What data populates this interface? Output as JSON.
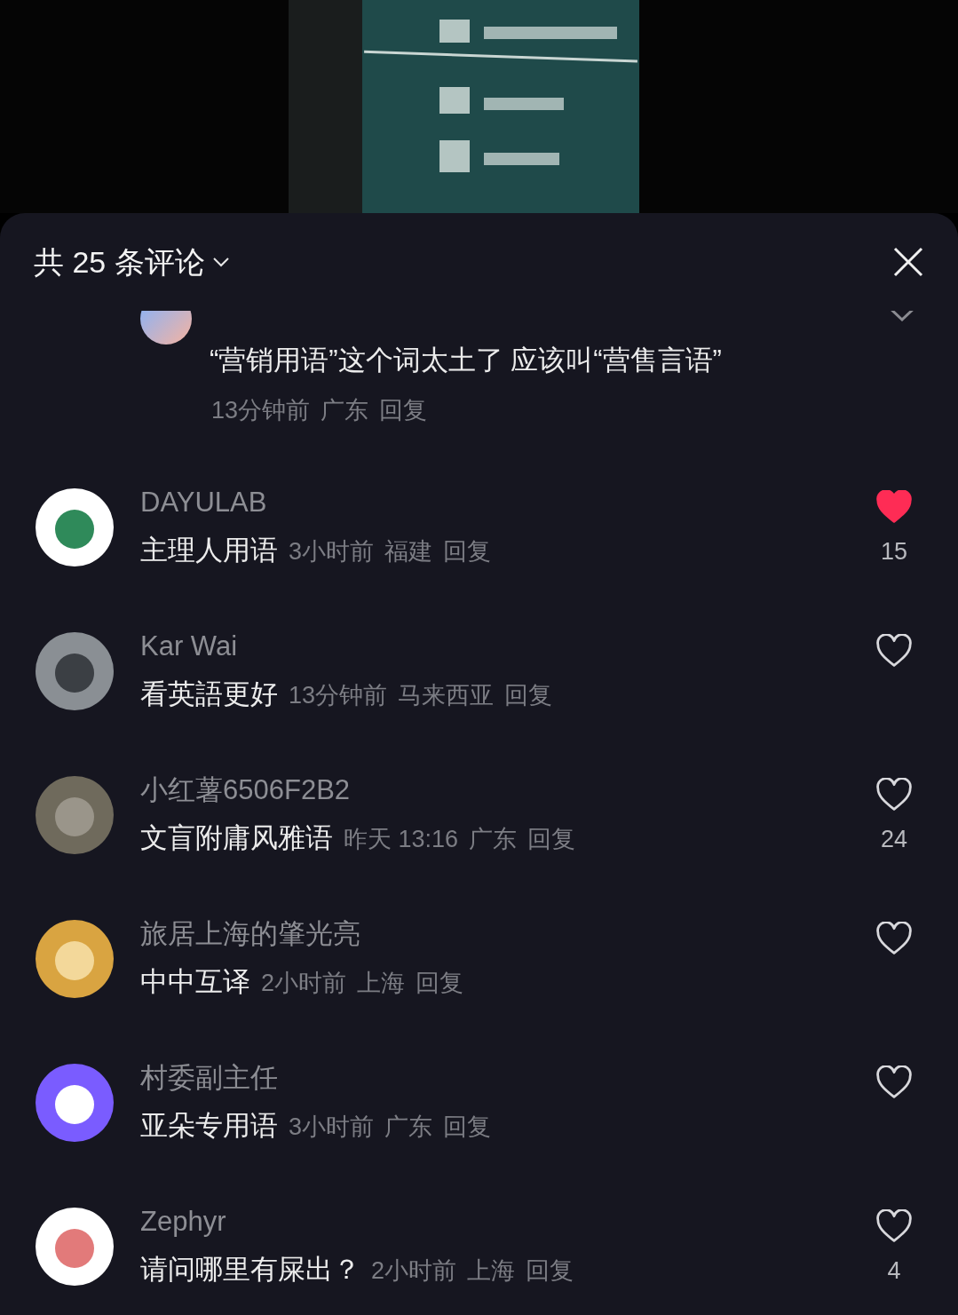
{
  "header": {
    "title": "共 25 条评论"
  },
  "reply": {
    "text": "“营销用语”这个词太土了 应该叫“营售言语”",
    "time": "13分钟前",
    "location": "广东",
    "reply_label": "回复"
  },
  "comments": [
    {
      "name": "DAYULAB",
      "text": "主理人用语",
      "time": "3小时前",
      "location": "福建",
      "reply_label": "回复",
      "liked": true,
      "like_count": "15"
    },
    {
      "name": "Kar Wai",
      "text": "看英語更好",
      "time": "13分钟前",
      "location": "马来西亚",
      "reply_label": "回复",
      "liked": false
    },
    {
      "name": "小红薯6506F2B2",
      "text": "文盲附庸风雅语",
      "time": "昨天 13:16",
      "location": "广东",
      "reply_label": "回复",
      "liked": false,
      "like_count": "24"
    },
    {
      "name": "旅居上海的肇光亮",
      "text": "中中互译",
      "time": "2小时前",
      "location": "上海",
      "reply_label": "回复",
      "liked": false
    },
    {
      "name": "村委副主任",
      "text": "亚朵专用语",
      "time": "3小时前",
      "location": "广东",
      "reply_label": "回复",
      "liked": false
    },
    {
      "name": "Zephyr",
      "text": "请问哪里有屎出？",
      "time": "2小时前",
      "location": "上海",
      "reply_label": "回复",
      "liked": false,
      "like_count": "4"
    }
  ]
}
